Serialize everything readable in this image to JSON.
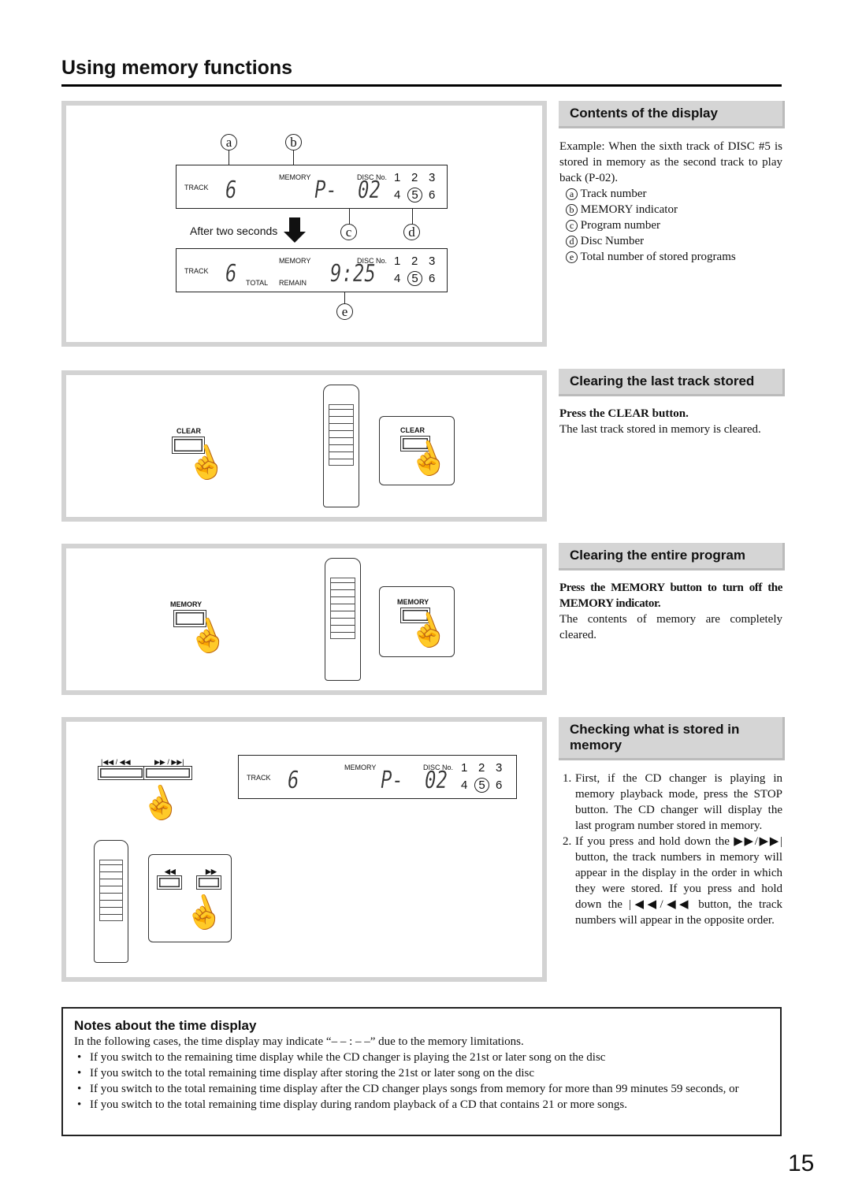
{
  "title": "Using memory functions",
  "page_number": "15",
  "display": {
    "track": "TRACK",
    "memory": "MEMORY",
    "disc_no": "DISC No.",
    "total": "TOTAL",
    "remain": "REMAIN",
    "track_digit": "6",
    "program": "P-",
    "program_num": "02",
    "time": "9:25",
    "discs": [
      "1",
      "2",
      "3",
      "4",
      "5",
      "6"
    ],
    "selected_disc": "5"
  },
  "diagram": {
    "labels": [
      "a",
      "b",
      "c",
      "d",
      "e"
    ],
    "after_two_seconds": "After two seconds",
    "clear_button": "CLEAR",
    "memory_button": "MEMORY",
    "prev_label": "|◀◀ / ◀◀",
    "next_label": "▶▶ / ▶▶|",
    "rew": "◀◀",
    "ff": "▶▶"
  },
  "sections": {
    "contents": {
      "heading": "Contents of the display",
      "intro": "Example: When the sixth track of DISC #5 is stored in memory as the second track to play back (P-02).",
      "items": [
        {
          "key": "a",
          "text": "Track number"
        },
        {
          "key": "b",
          "text": "MEMORY indicator"
        },
        {
          "key": "c",
          "text": "Program number"
        },
        {
          "key": "d",
          "text": "Disc Number"
        },
        {
          "key": "e",
          "text": "Total number of stored programs"
        }
      ]
    },
    "clear_last": {
      "heading": "Clearing the last track stored",
      "instruction": "Press the CLEAR button.",
      "text": "The last track stored in memory is cleared."
    },
    "clear_all": {
      "heading": "Clearing the entire program",
      "instruction": "Press the MEMORY button to turn off the MEMORY indicator.",
      "text": "The contents of memory are completely cleared."
    },
    "checking": {
      "heading": "Checking what is stored in memory",
      "steps": [
        "First, if the CD changer is playing in memory playback mode, press the STOP button. The CD changer will display the last program number stored in memory.",
        "If you press and hold down the ▶▶/▶▶| button, the track numbers in memory will appear in the display in the order in which they were stored. If you press and hold down the |◀◀/◀◀ button, the track numbers will appear in the opposite order."
      ]
    }
  },
  "notes": {
    "heading": "Notes about the time display",
    "intro": "In the following cases, the time display may indicate “– – : – –” due to the memory limitations.",
    "items": [
      "If you switch to the remaining time display while the CD changer is playing the 21st or later song on the disc",
      "If you switch to the total remaining time display after storing the 21st or later song on the disc",
      "If you switch to the total remaining time display after the CD changer plays songs from memory for more than 99 minutes 59 seconds, or",
      "If you switch to the total remaining time display during random playback of a CD that contains 21 or more songs."
    ]
  }
}
